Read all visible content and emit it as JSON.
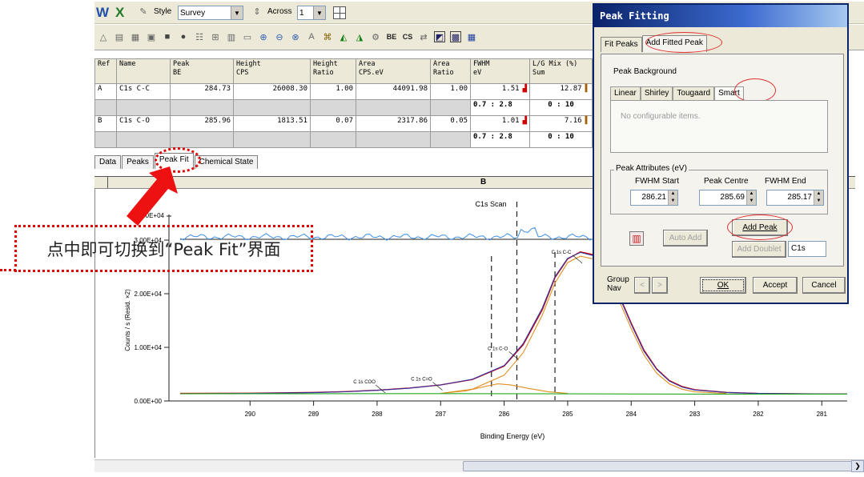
{
  "toolbar": {
    "logo_w": "W",
    "logo_x": "X",
    "style_label": "Style",
    "style_value": "Survey",
    "across_label": "Across",
    "across_value": "1"
  },
  "table": {
    "headers": [
      {
        "l1": "Ref",
        "l2": ""
      },
      {
        "l1": "Name",
        "l2": ""
      },
      {
        "l1": "Peak",
        "l2": "BE"
      },
      {
        "l1": "Height",
        "l2": "CPS"
      },
      {
        "l1": "Height",
        "l2": "Ratio"
      },
      {
        "l1": "Area",
        "l2": "CPS.eV"
      },
      {
        "l1": "Area",
        "l2": "Ratio"
      },
      {
        "l1": "FWHM",
        "l2": "eV"
      },
      {
        "l1": "L/G Mix (%)",
        "l2": "Sum"
      }
    ],
    "rows": [
      {
        "ref": "A",
        "name": "C1s C-C",
        "be": "284.73",
        "height": "26008.30",
        "hratio": "1.00",
        "area": "44091.98",
        "aratio": "1.00",
        "fwhm": "1.51",
        "lg": "12.87"
      },
      {
        "ref": "",
        "name": "",
        "be": "",
        "height": "",
        "hratio": "",
        "area": "",
        "aratio": "",
        "fwhm": "0.7 : 2.8",
        "lg": "0 : 10"
      },
      {
        "ref": "B",
        "name": "C1s C-O",
        "be": "285.96",
        "height": "1813.51",
        "hratio": "0.07",
        "area": "2317.86",
        "aratio": "0.05",
        "fwhm": "1.01",
        "lg": "7.16"
      },
      {
        "ref": "",
        "name": "",
        "be": "",
        "height": "",
        "hratio": "",
        "area": "",
        "aratio": "",
        "fwhm": "0.7 : 2.8",
        "lg": "0 : 10"
      }
    ]
  },
  "tabs": [
    "Data",
    "Peaks",
    "Peak Fit",
    "Chemical State"
  ],
  "annotation": "点中即可切换到“Peak Fit”界面",
  "chart_header": "B",
  "chart_data": {
    "type": "line",
    "title": "C1s Scan",
    "xlabel": "Binding Energy (eV)",
    "ylabel": "Counts / s  (Resid. ×2)",
    "xlim": [
      291.1,
      280.6
    ],
    "ylim": [
      0,
      30000
    ],
    "x_ticks": [
      290,
      289,
      288,
      287,
      286,
      285,
      284,
      283,
      282,
      281
    ],
    "y_ticks": [
      {
        "value": 0,
        "label": "0.00E+00"
      },
      {
        "value": 10000,
        "label": "1.00E+04"
      },
      {
        "value": 20000,
        "label": "2.00E+04"
      },
      {
        "value": 30000,
        "label": "3.00E+04"
      }
    ],
    "residual_tick_label": "4.00E+04",
    "peak_labels": [
      {
        "text": "C 1s C-C",
        "x": 285.1,
        "y": 27500
      },
      {
        "text": "C 1s C-O",
        "x": 286.1,
        "y": 9500
      },
      {
        "text": "C 1s C=O",
        "x": 287.3,
        "y": 3800
      },
      {
        "text": "C 1s COO",
        "x": 288.2,
        "y": 3300
      }
    ],
    "dashed_markers": [
      286.2,
      285.8,
      285.2
    ],
    "series": [
      {
        "color": "#cc0000",
        "style": "data",
        "points": [
          [
            291.1,
            1400
          ],
          [
            290,
            1450
          ],
          [
            289,
            1600
          ],
          [
            288.5,
            1750
          ],
          [
            288,
            2000
          ],
          [
            287.5,
            2400
          ],
          [
            287,
            3000
          ],
          [
            286.5,
            4000
          ],
          [
            286,
            6500
          ],
          [
            285.7,
            10500
          ],
          [
            285.4,
            17000
          ],
          [
            285.2,
            23000
          ],
          [
            285.0,
            26500
          ],
          [
            284.8,
            27800
          ],
          [
            284.6,
            27300
          ],
          [
            284.4,
            24500
          ],
          [
            284.2,
            20000
          ],
          [
            284.0,
            14500
          ],
          [
            283.8,
            9500
          ],
          [
            283.6,
            6000
          ],
          [
            283.4,
            3800
          ],
          [
            283.2,
            2700
          ],
          [
            283,
            2100
          ],
          [
            282.5,
            1600
          ],
          [
            282,
            1400
          ],
          [
            281,
            1300
          ],
          [
            280.6,
            1300
          ]
        ]
      },
      {
        "color": "#3333aa",
        "style": "envelope",
        "points": [
          [
            291.1,
            1350
          ],
          [
            290,
            1400
          ],
          [
            289,
            1550
          ],
          [
            288.5,
            1720
          ],
          [
            288,
            1980
          ],
          [
            287.5,
            2380
          ],
          [
            287,
            2980
          ],
          [
            286.5,
            4050
          ],
          [
            286,
            6600
          ],
          [
            285.7,
            10700
          ],
          [
            285.4,
            17300
          ],
          [
            285.2,
            23200
          ],
          [
            285.0,
            26600
          ],
          [
            284.8,
            27700
          ],
          [
            284.6,
            27100
          ],
          [
            284.4,
            24300
          ],
          [
            284.2,
            19800
          ],
          [
            284.0,
            14300
          ],
          [
            283.8,
            9300
          ],
          [
            283.6,
            5900
          ],
          [
            283.4,
            3700
          ],
          [
            283.2,
            2600
          ],
          [
            283,
            2050
          ],
          [
            282.5,
            1580
          ],
          [
            282,
            1400
          ],
          [
            281,
            1300
          ],
          [
            280.6,
            1300
          ]
        ]
      },
      {
        "color": "#e09020",
        "style": "component",
        "points": [
          [
            287,
            1400
          ],
          [
            286.5,
            2200
          ],
          [
            286,
            4800
          ],
          [
            285.7,
            9000
          ],
          [
            285.4,
            16000
          ],
          [
            285.2,
            22000
          ],
          [
            285,
            25800
          ],
          [
            284.8,
            27000
          ],
          [
            284.6,
            26500
          ],
          [
            284.4,
            23500
          ],
          [
            284.2,
            19000
          ],
          [
            284,
            13500
          ],
          [
            283.8,
            8600
          ],
          [
            283.6,
            5200
          ],
          [
            283.4,
            3200
          ],
          [
            283.2,
            2200
          ],
          [
            283,
            1700
          ],
          [
            282.5,
            1400
          ]
        ]
      },
      {
        "color": "#e09020",
        "style": "component",
        "points": [
          [
            287,
            1400
          ],
          [
            286.6,
            1900
          ],
          [
            286.3,
            2700
          ],
          [
            286.1,
            3200
          ],
          [
            285.9,
            3000
          ],
          [
            285.6,
            2300
          ],
          [
            285.3,
            1700
          ],
          [
            285,
            1400
          ]
        ]
      },
      {
        "color": "#22aa22",
        "style": "background",
        "points": [
          [
            291.1,
            1350
          ],
          [
            287,
            1380
          ],
          [
            285,
            1330
          ],
          [
            283,
            1290
          ],
          [
            280.6,
            1280
          ]
        ]
      }
    ]
  },
  "dialog": {
    "title": "Peak Fitting",
    "tabs": [
      "Fit Peaks",
      "Add Fitted Peak"
    ],
    "peak_background": "Peak Background",
    "subtabs": [
      "Linear",
      "Shirley",
      "Tougaard",
      "Smart"
    ],
    "no_items": "No configurable items.",
    "attrs_group": "Peak Attributes (eV)",
    "fwhm_start_label": "FWHM Start",
    "peak_centre_label": "Peak Centre",
    "fwhm_end_label": "FWHM End",
    "fwhm_start": "286.21",
    "peak_centre": "285.69",
    "fwhm_end": "285.17",
    "auto_add": "Auto Add",
    "add_peak": "Add Peak",
    "add_doublet": "Add Doublet",
    "doublet_value": "C1s",
    "group_nav_1": "Group",
    "group_nav_2": "Nav",
    "ok": "OK",
    "accept": "Accept",
    "cancel": "Cancel"
  }
}
